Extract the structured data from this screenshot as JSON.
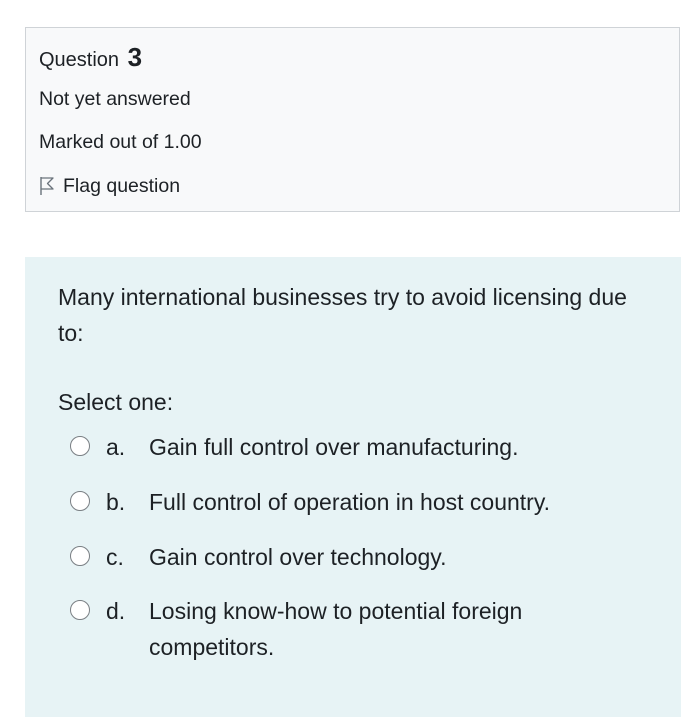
{
  "question_info": {
    "label": "Question",
    "number": "3",
    "state": "Not yet answered",
    "grade": "Marked out of 1.00",
    "flag_label": "Flag question"
  },
  "question": {
    "text": "Many international businesses try to avoid licensing due to:",
    "prompt": "Select one:",
    "options": [
      {
        "letter": "a.",
        "text": "Gain full control over manufacturing."
      },
      {
        "letter": "b.",
        "text": "Full control of operation in host country."
      },
      {
        "letter": "c.",
        "text": "Gain control over technology."
      },
      {
        "letter": "d.",
        "text": "Losing know-how to potential foreign competitors."
      }
    ]
  }
}
